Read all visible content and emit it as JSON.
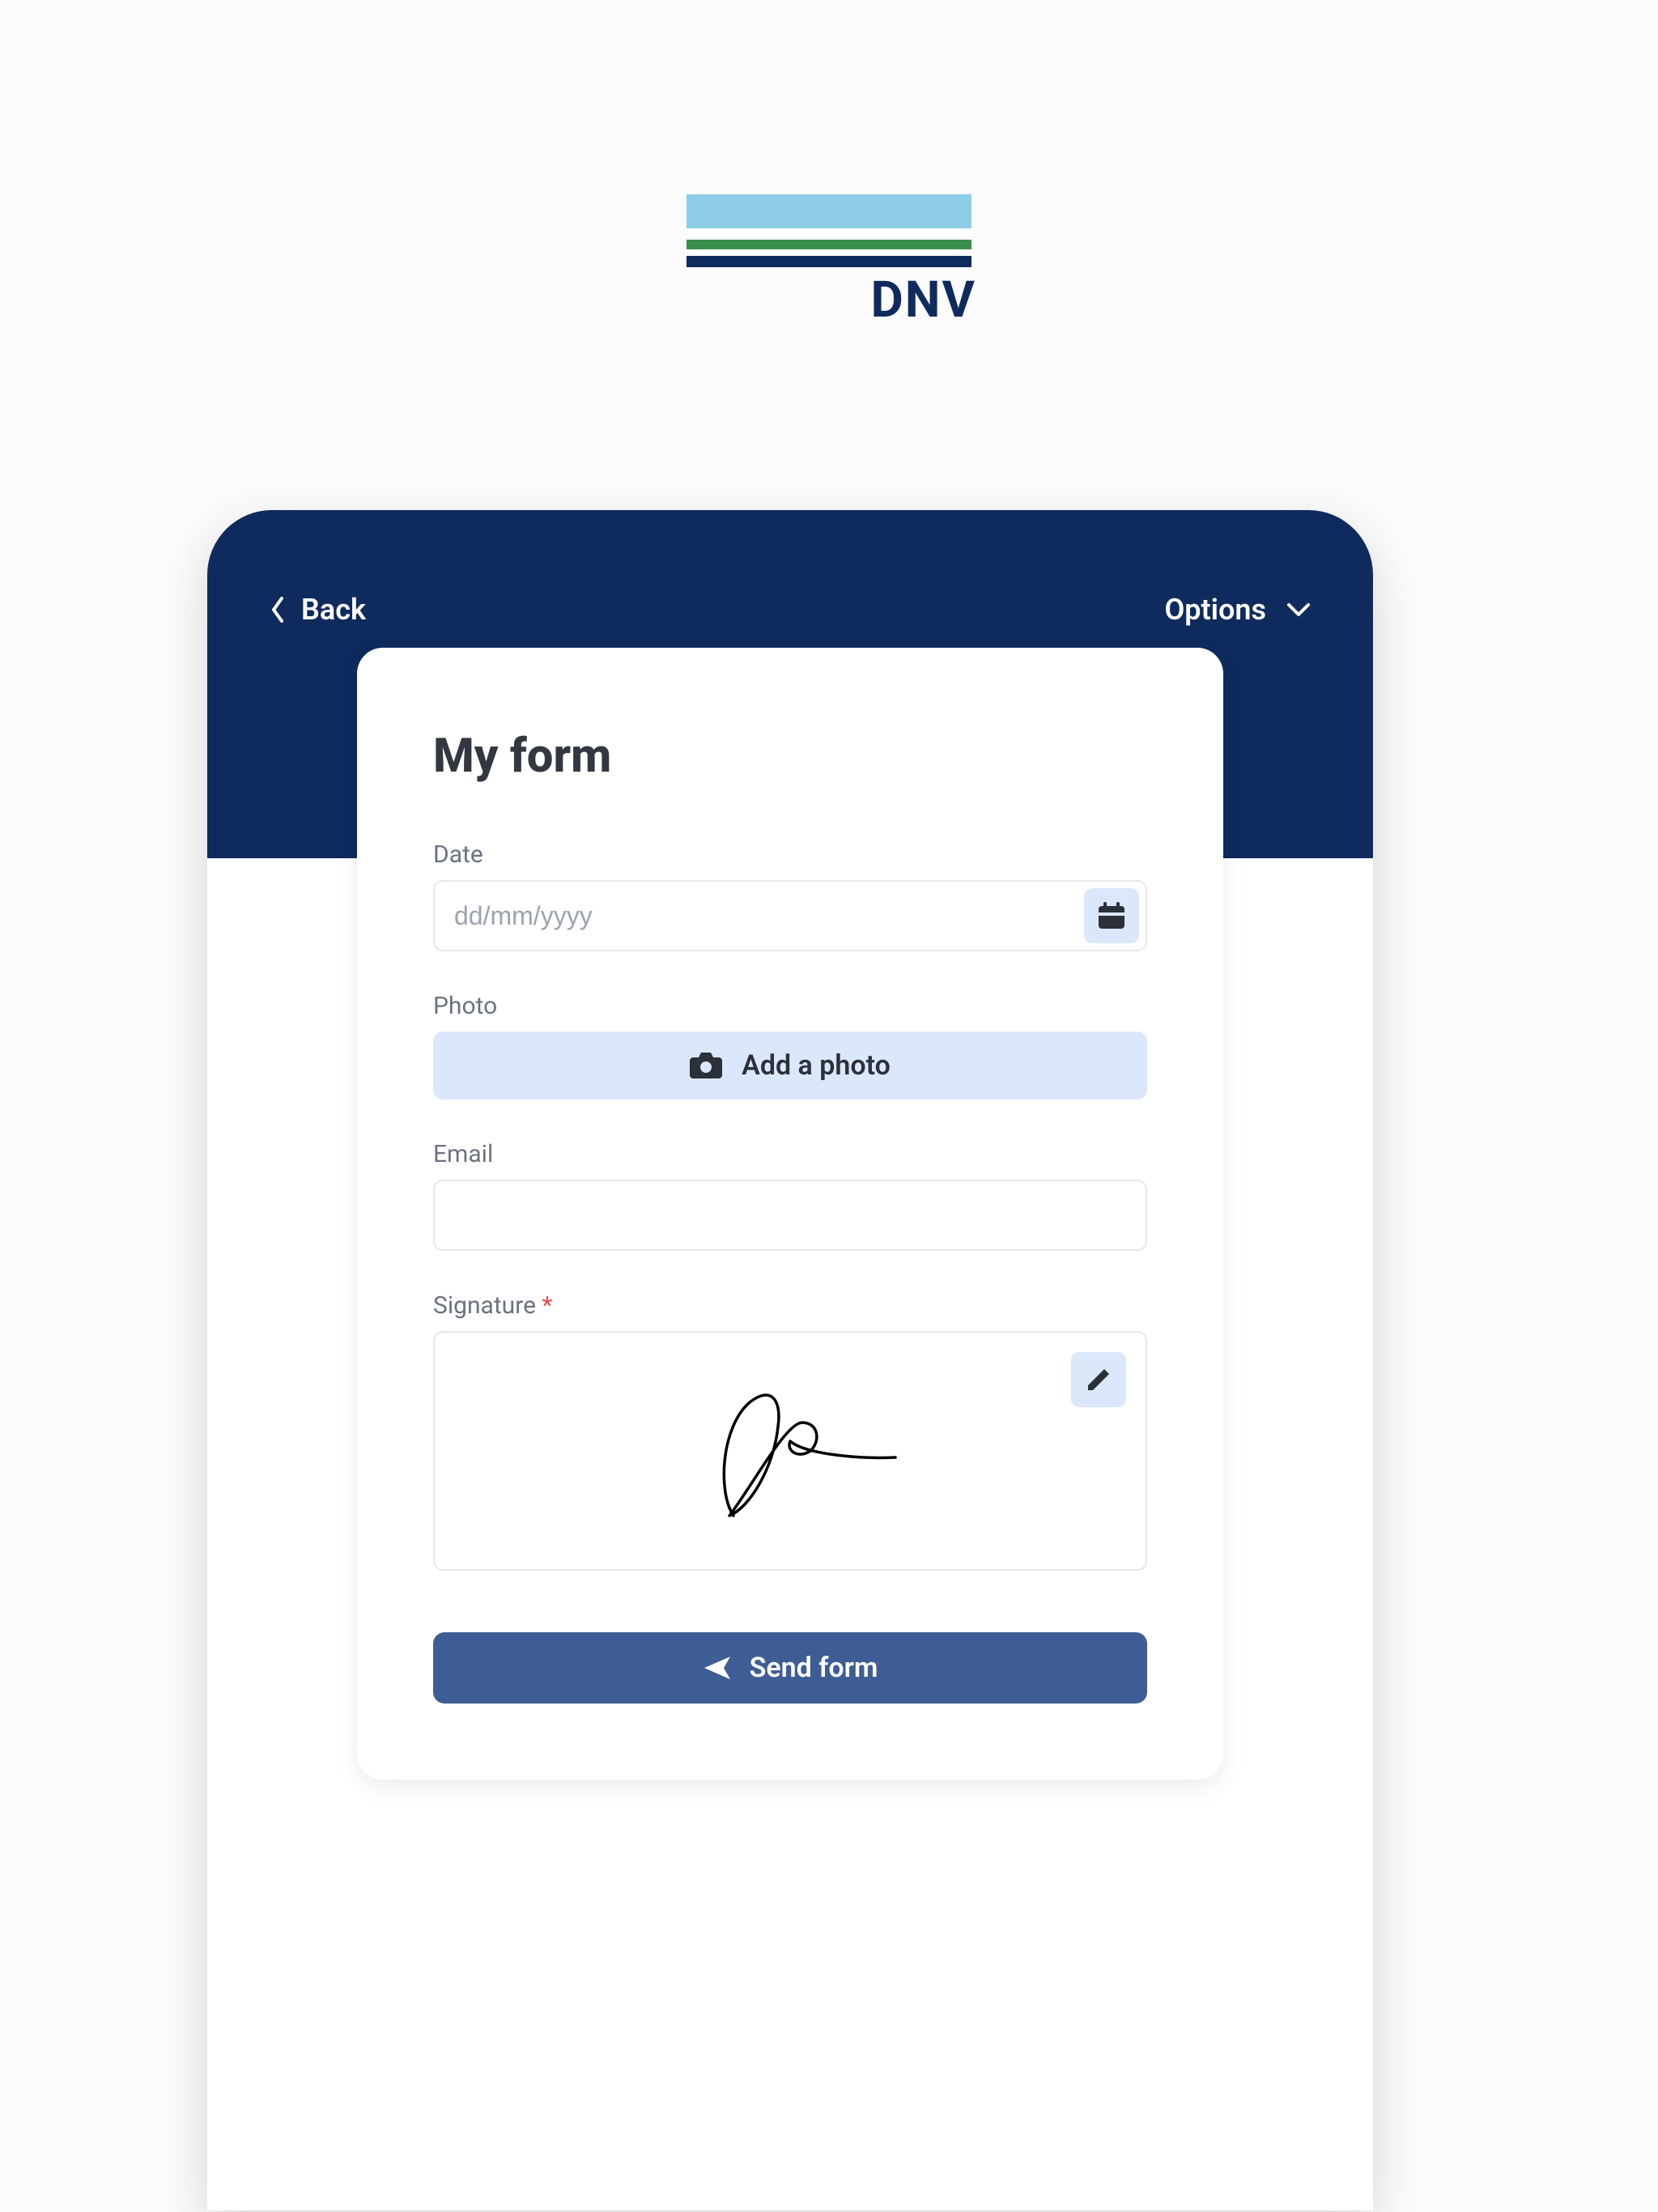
{
  "logo": {
    "text": "DNV"
  },
  "nav": {
    "back_label": "Back",
    "options_label": "Options"
  },
  "form": {
    "title": "My form",
    "date": {
      "label": "Date",
      "placeholder": "dd/mm/yyyy",
      "value": ""
    },
    "photo": {
      "label": "Photo",
      "button_label": "Add a photo"
    },
    "email": {
      "label": "Email",
      "value": ""
    },
    "signature": {
      "label": "Signature",
      "required": "*"
    },
    "submit_label": "Send form"
  }
}
